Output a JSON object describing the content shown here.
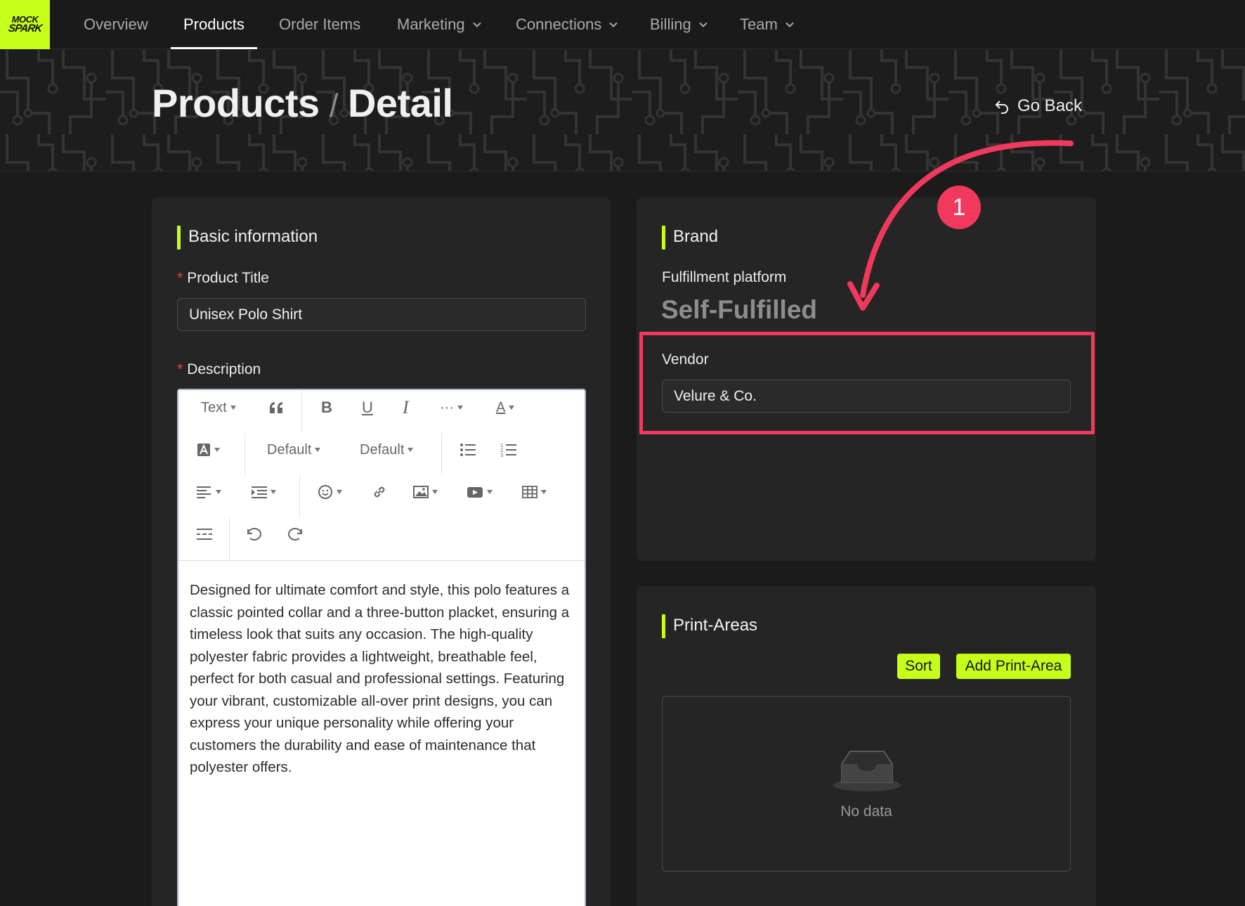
{
  "nav": {
    "logo_line1": "MOCK",
    "logo_line2": "SPARK",
    "items": [
      {
        "label": "Overview"
      },
      {
        "label": "Products"
      },
      {
        "label": "Order Items"
      },
      {
        "label": "Marketing"
      },
      {
        "label": "Connections"
      },
      {
        "label": "Billing"
      },
      {
        "label": "Team"
      }
    ]
  },
  "header": {
    "title_part1": "Products",
    "separator": "/",
    "title_part2": "Detail",
    "go_back": "Go Back"
  },
  "basic_info": {
    "title": "Basic information",
    "product_title_label": "Product Title",
    "product_title_value": "Unisex Polo Shirt",
    "description_label": "Description",
    "required_marker": "*",
    "toolbar": {
      "text_style": "Text",
      "font_size": "Default",
      "font_family": "Default"
    },
    "description_text": "Designed for ultimate comfort and style, this polo features a classic pointed collar and a three-button placket, ensuring a timeless look that suits any occasion. The high-quality polyester fabric provides a lightweight, breathable feel, perfect for both casual and professional settings. Featuring your vibrant, customizable all-over print designs, you can express your unique personality while offering your customers the durability and ease of maintenance that polyester offers."
  },
  "brand": {
    "title": "Brand",
    "platform_label": "Fulfillment platform",
    "platform_value": "Self-Fulfilled",
    "vendor_label": "Vendor",
    "vendor_value": "Velure & Co.",
    "annotation_number": "1"
  },
  "print_areas": {
    "title": "Print-Areas",
    "sort_label": "Sort",
    "add_label": "Add Print-Area",
    "empty_text": "No data"
  },
  "colors": {
    "accent": "#c6ff1a",
    "annotation": "#f0395c",
    "background": "#1b1b1b",
    "card": "#252525"
  }
}
